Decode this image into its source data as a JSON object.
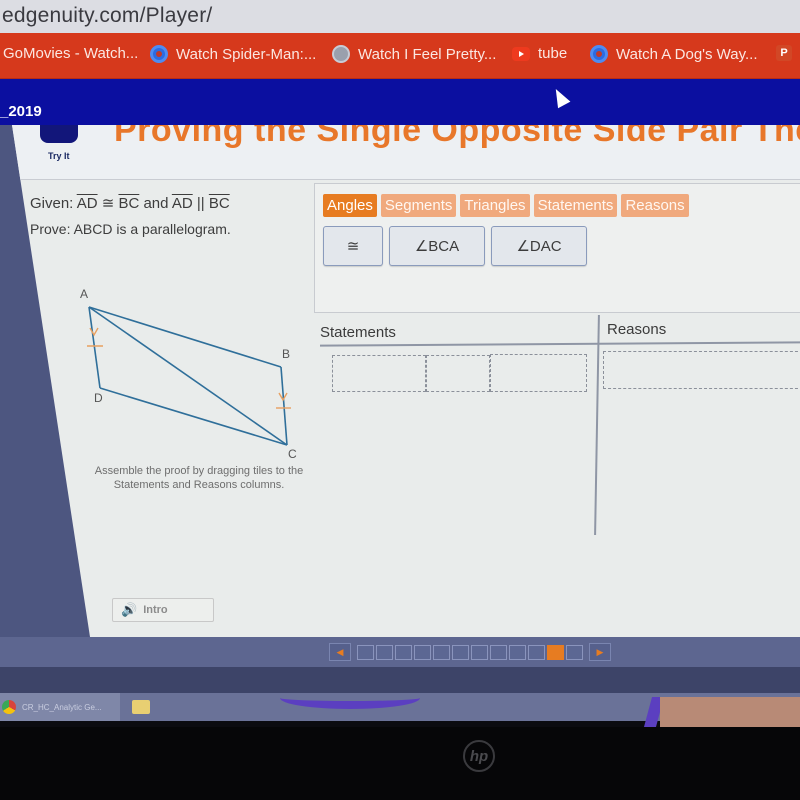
{
  "browser": {
    "url": "edgenuity.com/Player/",
    "bookmarks": [
      {
        "label": "GoMovies - Watch...",
        "icon": "none"
      },
      {
        "label": "Watch Spider-Man:...",
        "icon": "blue-circle-icon"
      },
      {
        "label": "Watch I Feel Pretty...",
        "icon": "grey-globe-icon"
      },
      {
        "label": "tube",
        "icon": "youtube-icon"
      },
      {
        "label": "Watch A Dog's Way...",
        "icon": "blue-circle-icon"
      },
      {
        "label": "P",
        "icon": "powerpoint-icon"
      }
    ]
  },
  "course_bar": {
    "course_name": "_2019"
  },
  "lesson": {
    "title": "Proving the Single Opposite Side Pair Theorem",
    "mode_label": "Try It",
    "given_prefix": "Given: ",
    "given_seg1": "AD",
    "given_cong": " ≅ ",
    "given_seg2": "BC",
    "given_and": " and ",
    "given_seg3": "AD",
    "given_par": " || ",
    "given_seg4": "BC",
    "prove": "Prove: ABCD is a parallelogram.",
    "instructions": "Assemble the proof by dragging tiles to the Statements and Reasons columns."
  },
  "diagram": {
    "vertices": {
      "A": "A",
      "B": "B",
      "C": "C",
      "D": "D"
    },
    "line_color": "#2f6f9a",
    "mark_color": "#e8a060"
  },
  "palette": {
    "tabs": [
      {
        "label": "Angles",
        "active": true
      },
      {
        "label": "Segments",
        "active": false
      },
      {
        "label": "Triangles",
        "active": false
      },
      {
        "label": "Statements",
        "active": false
      },
      {
        "label": "Reasons",
        "active": false
      }
    ],
    "tiles": [
      "≅",
      "∠BCA",
      "∠DAC"
    ]
  },
  "proof": {
    "statements_header": "Statements",
    "reasons_header": "Reasons"
  },
  "audio": {
    "intro_label": "Intro"
  },
  "pager": {
    "total": 12,
    "current": 11,
    "prev_icon": "◀",
    "next_icon": "▶"
  },
  "taskbar": {
    "chrome_task_label": "CR_HC_Analytic Ge..."
  },
  "device": {
    "brand": "hp"
  },
  "colors": {
    "accent_orange": "#e77c21",
    "bookmarks_red": "#d6391c",
    "course_blue": "#0b0fa0"
  }
}
